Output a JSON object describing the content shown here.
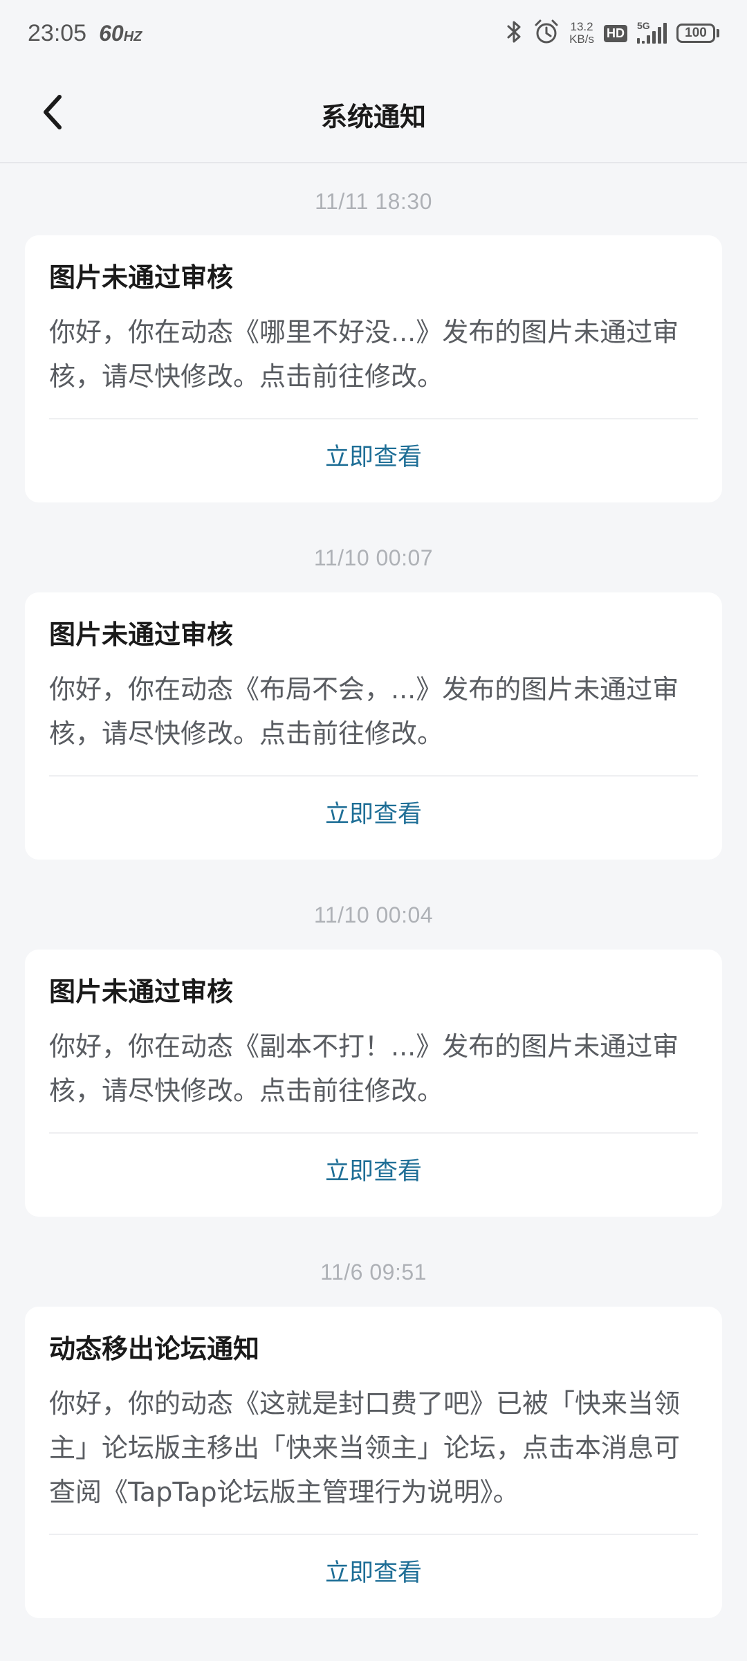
{
  "status_bar": {
    "time": "23:05",
    "refresh_rate": "60",
    "refresh_unit": "HZ",
    "speed_value": "13.2",
    "speed_unit": "KB/s",
    "hd_label": "HD",
    "network_label": "5G",
    "battery": "100",
    "icons": [
      "bluetooth-icon",
      "alarm-icon",
      "signal-icon",
      "battery-icon"
    ]
  },
  "nav": {
    "title": "系统通知",
    "back_icon": "chevron-left-icon"
  },
  "notifications": [
    {
      "time": "11/11  18:30",
      "title": "图片未通过审核",
      "body": "你好，你在动态《哪里不好没...》发布的图片未通过审核，请尽快修改。点击前往修改。",
      "action": "立即查看"
    },
    {
      "time": "11/10  00:07",
      "title": "图片未通过审核",
      "body": "你好，你在动态《布局不会，...》发布的图片未通过审核，请尽快修改。点击前往修改。",
      "action": "立即查看"
    },
    {
      "time": "11/10  00:04",
      "title": "图片未通过审核",
      "body": "你好，你在动态《副本不打！...》发布的图片未通过审核，请尽快修改。点击前往修改。",
      "action": "立即查看"
    },
    {
      "time": "11/6  09:51",
      "title": "动态移出论坛通知",
      "body": "你好，你的动态《这就是封口费了吧》已被「快来当领主」论坛版主移出「快来当领主」论坛，点击本消息可查阅《TapTap论坛版主管理行为说明》。",
      "action": "立即查看"
    }
  ],
  "colors": {
    "background": "#f5f6f8",
    "card": "#ffffff",
    "link": "#1e6e96",
    "timestamp": "#aeb1b6"
  }
}
